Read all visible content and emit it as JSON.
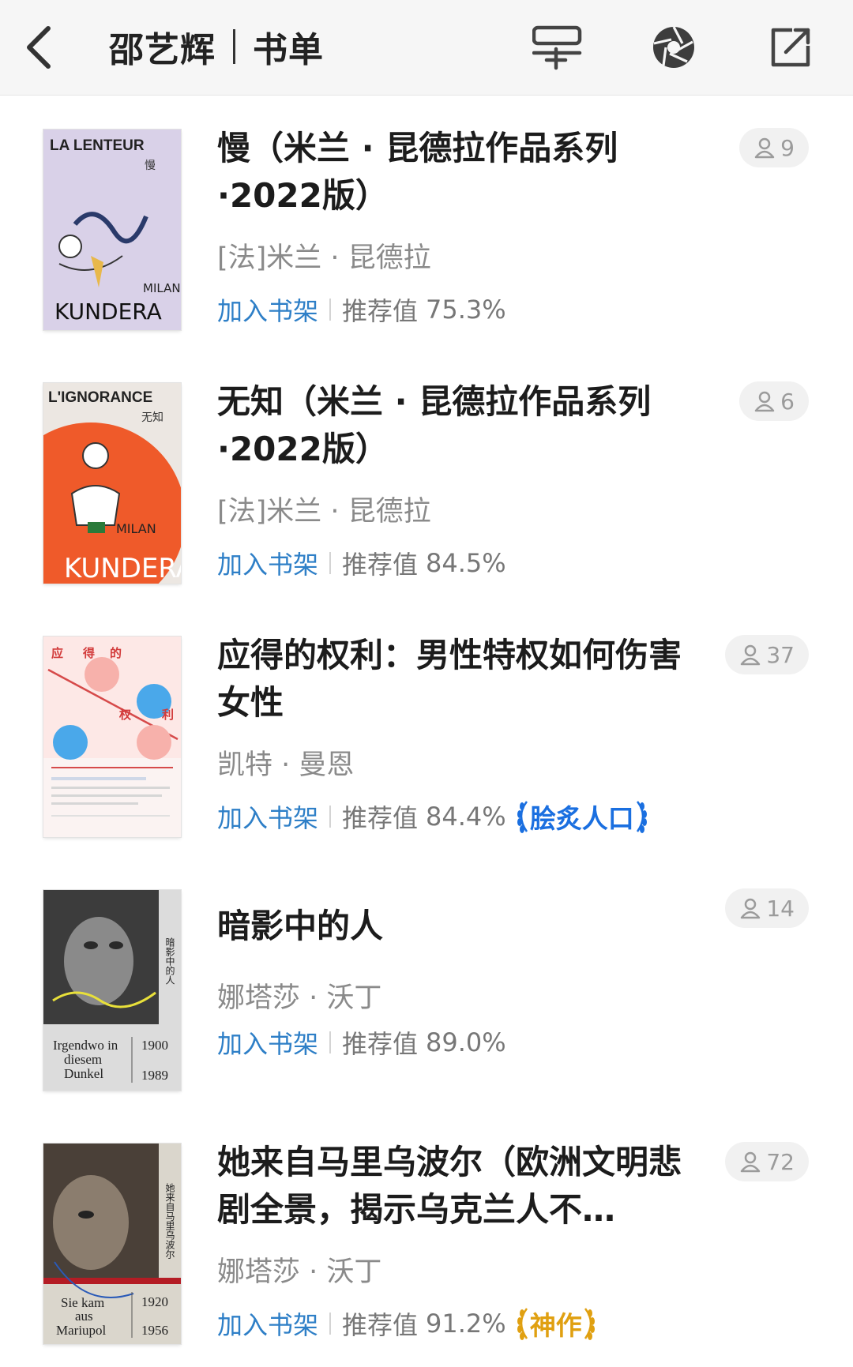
{
  "header": {
    "title_name": "邵艺辉",
    "title_section": "书单",
    "icons": [
      "back-icon",
      "list-add-icon",
      "shutter-icon",
      "share-icon"
    ]
  },
  "books": [
    {
      "title": "慢（米兰 · 昆德拉作品系列·2022版）",
      "author": "[法]米兰 · 昆德拉",
      "add_label": "加入书架",
      "rec_label": "推荐值",
      "rec_value": "75.3%",
      "readers": "9",
      "badge": "",
      "cover_text": [
        "LA LENTEUR",
        "慢",
        "MILAN",
        "KUNDERA"
      ]
    },
    {
      "title": "无知（米兰 · 昆德拉作品系列·2022版）",
      "author": "[法]米兰 · 昆德拉",
      "add_label": "加入书架",
      "rec_label": "推荐值",
      "rec_value": "84.5%",
      "readers": "6",
      "badge": "",
      "cover_text": [
        "L'IGNORANCE",
        "无知",
        "MILAN",
        "KUNDERA"
      ]
    },
    {
      "title": "应得的权利：男性特权如何伤害女性",
      "author": "凯特 · 曼恩",
      "add_label": "加入书架",
      "rec_label": "推荐值",
      "rec_value": "84.4%",
      "readers": "37",
      "badge": "脍炙人口",
      "cover_text": [
        "应",
        "得",
        "的",
        "权",
        "利"
      ]
    },
    {
      "title": "暗影中的人",
      "author": "娜塔莎 · 沃丁",
      "add_label": "加入书架",
      "rec_label": "推荐值",
      "rec_value": "89.0%",
      "readers": "14",
      "badge": "",
      "cover_text": [
        "Irgendwo in",
        "diesem",
        "Dunkel",
        "1900",
        "1989",
        "暗影中的人"
      ]
    },
    {
      "title": "她来自马里乌波尔（欧洲文明悲剧全景，揭示乌克兰人不…",
      "author": "娜塔莎 · 沃丁",
      "add_label": "加入书架",
      "rec_label": "推荐值",
      "rec_value": "91.2%",
      "readers": "72",
      "badge": "神作",
      "cover_text": [
        "Sie kam",
        "aus",
        "Mariupol",
        "1920",
        "1956",
        "她来自马里乌波尔"
      ]
    }
  ],
  "colors": {
    "link_blue": "#2e7fc7",
    "badge_blue": "#1a6fe0",
    "badge_gold": "#e0a011",
    "header_bg": "#f6f6f6"
  }
}
